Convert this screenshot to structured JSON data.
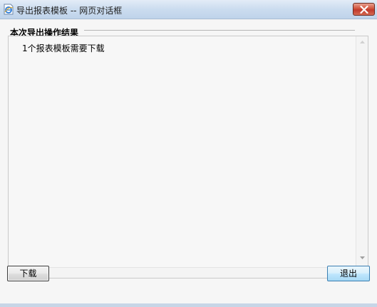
{
  "window": {
    "title": "导出报表模板 -- 网页对话框",
    "icon": "ie-page-icon",
    "close_icon": "close-x-icon"
  },
  "group": {
    "title": "本次导出操作结果"
  },
  "result": {
    "message": "1个报表模板需要下载"
  },
  "buttons": {
    "download_label": "下载",
    "exit_label": "退出"
  },
  "colors": {
    "titlebar": "#cbdcef",
    "close_button": "#c0392b",
    "panel_background": "#f7f7f7"
  }
}
